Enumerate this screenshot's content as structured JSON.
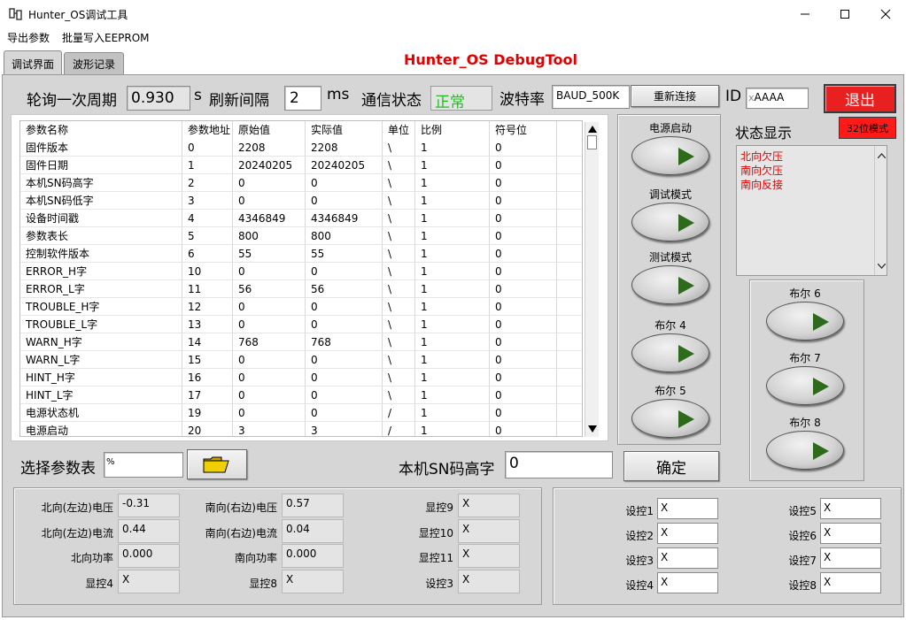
{
  "window": {
    "title": "Hunter_OS调试工具"
  },
  "menu": [
    "导出参数",
    "批量写入EEPROM"
  ],
  "tabs": [
    {
      "label": "调试界面"
    },
    {
      "label": "波形记录"
    }
  ],
  "app_title": "Hunter_OS DebugTool",
  "header": {
    "poll_label": "轮询一次周期",
    "poll_value": "0.930",
    "poll_unit": "s",
    "refresh_label": "刷新间隔",
    "refresh_value": "2",
    "refresh_unit": "ms",
    "comm_label": "通信状态",
    "comm_value": "正常",
    "baud_label": "波特率",
    "baud_value": "BAUD_500K",
    "reconnect_label": "重新连接",
    "id_label": "ID",
    "id_value": "AAAA",
    "id_prefix": "x",
    "exit_label": "退出",
    "mode_label": "32位模式"
  },
  "table": {
    "columns": [
      "参数名称",
      "参数地址",
      "原始值",
      "实际值",
      "单位",
      "比例",
      "符号位"
    ],
    "rows": [
      [
        "固件版本",
        "0",
        "2208",
        "2208",
        "\\",
        "1",
        "0"
      ],
      [
        "固件日期",
        "1",
        "20240205",
        "20240205",
        "\\",
        "1",
        "0"
      ],
      [
        "本机SN码高字",
        "2",
        "0",
        "0",
        "\\",
        "1",
        "0"
      ],
      [
        "本机SN码低字",
        "3",
        "0",
        "0",
        "\\",
        "1",
        "0"
      ],
      [
        "设备时间戳",
        "4",
        "4346849",
        "4346849",
        "\\",
        "1",
        "0"
      ],
      [
        "参数表长",
        "5",
        "800",
        "800",
        "\\",
        "1",
        "0"
      ],
      [
        "控制软件版本",
        "6",
        "55",
        "55",
        "\\",
        "1",
        "0"
      ],
      [
        "ERROR_H字",
        "10",
        "0",
        "0",
        "\\",
        "1",
        "0"
      ],
      [
        "ERROR_L字",
        "11",
        "56",
        "56",
        "\\",
        "1",
        "0"
      ],
      [
        "TROUBLE_H字",
        "12",
        "0",
        "0",
        "\\",
        "1",
        "0"
      ],
      [
        "TROUBLE_L字",
        "13",
        "0",
        "0",
        "\\",
        "1",
        "0"
      ],
      [
        "WARN_H字",
        "14",
        "768",
        "768",
        "\\",
        "1",
        "0"
      ],
      [
        "WARN_L字",
        "15",
        "0",
        "0",
        "\\",
        "1",
        "0"
      ],
      [
        "HINT_H字",
        "16",
        "0",
        "0",
        "\\",
        "1",
        "0"
      ],
      [
        "HINT_L字",
        "17",
        "0",
        "0",
        "\\",
        "1",
        "0"
      ],
      [
        "电源状态机",
        "19",
        "0",
        "0",
        "/",
        "1",
        "0"
      ],
      [
        "电源启动",
        "20",
        "3",
        "3",
        "/",
        "1",
        "0"
      ]
    ]
  },
  "bools_mid": [
    "电源启动",
    "调试模式",
    "测试模式",
    "布尔 4",
    "布尔 5"
  ],
  "status": {
    "label": "状态显示",
    "items": [
      "北向欠压",
      "南向欠压",
      "南向反接"
    ]
  },
  "bools_right": [
    "布尔 6",
    "布尔 7",
    "布尔 8"
  ],
  "select": {
    "label": "选择参数表",
    "prefix": "%",
    "value": ""
  },
  "sn": {
    "label": "本机SN码高字",
    "value": "0",
    "confirm_label": "确定"
  },
  "readouts": [
    {
      "label": "北向(左边)电压",
      "value": "-0.31"
    },
    {
      "label": "南向(右边)电压",
      "value": "0.57"
    },
    {
      "label": "显控9",
      "value": "X"
    },
    {
      "label": "北向(左边)电流",
      "value": "0.44"
    },
    {
      "label": "南向(右边)电流",
      "value": "0.04"
    },
    {
      "label": "显控10",
      "value": "X"
    },
    {
      "label": "北向功率",
      "value": "0.000"
    },
    {
      "label": "南向功率",
      "value": "0.000"
    },
    {
      "label": "显控11",
      "value": "X"
    },
    {
      "label": "显控4",
      "value": "X"
    },
    {
      "label": "显控8",
      "value": "X"
    },
    {
      "label": "设控3",
      "value": "X"
    }
  ],
  "controls": [
    {
      "label": "设控1",
      "value": "X"
    },
    {
      "label": "设控5",
      "value": "X"
    },
    {
      "label": "设控2",
      "value": "X"
    },
    {
      "label": "设控6",
      "value": "X"
    },
    {
      "label": "设控3",
      "value": "X"
    },
    {
      "label": "设控7",
      "value": "X"
    },
    {
      "label": "设控4",
      "value": "X"
    },
    {
      "label": "设控8",
      "value": "X"
    }
  ]
}
